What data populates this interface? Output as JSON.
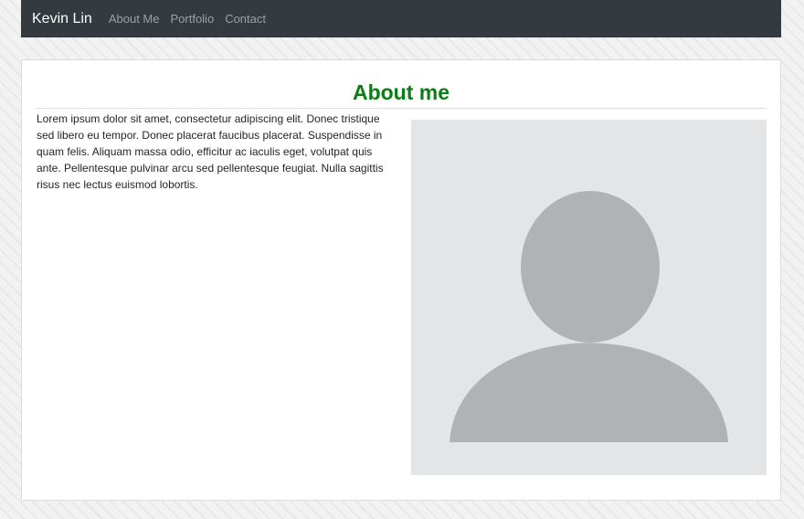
{
  "nav": {
    "brand": "Kevin Lin",
    "links": [
      "About Me",
      "Portfolio",
      "Contact"
    ]
  },
  "about": {
    "title": "About me",
    "body": "Lorem ipsum dolor sit amet, consectetur adipiscing elit. Donec tristique sed libero eu tempor. Donec placerat faucibus placerat. Suspendisse in quam felis. Aliquam massa odio, efficitur ac iaculis eget, volutpat quis ante. Pellentesque pulvinar arcu sed pellentesque feugiat. Nulla sagittis risus nec lectus euismod lobortis.",
    "avatar_icon": "user-placeholder-icon"
  },
  "colors": {
    "navbar": "#343a40",
    "title": "#0a7d14",
    "avatar_bg": "#e4e5e7",
    "avatar_fg": "#afb3b6"
  }
}
